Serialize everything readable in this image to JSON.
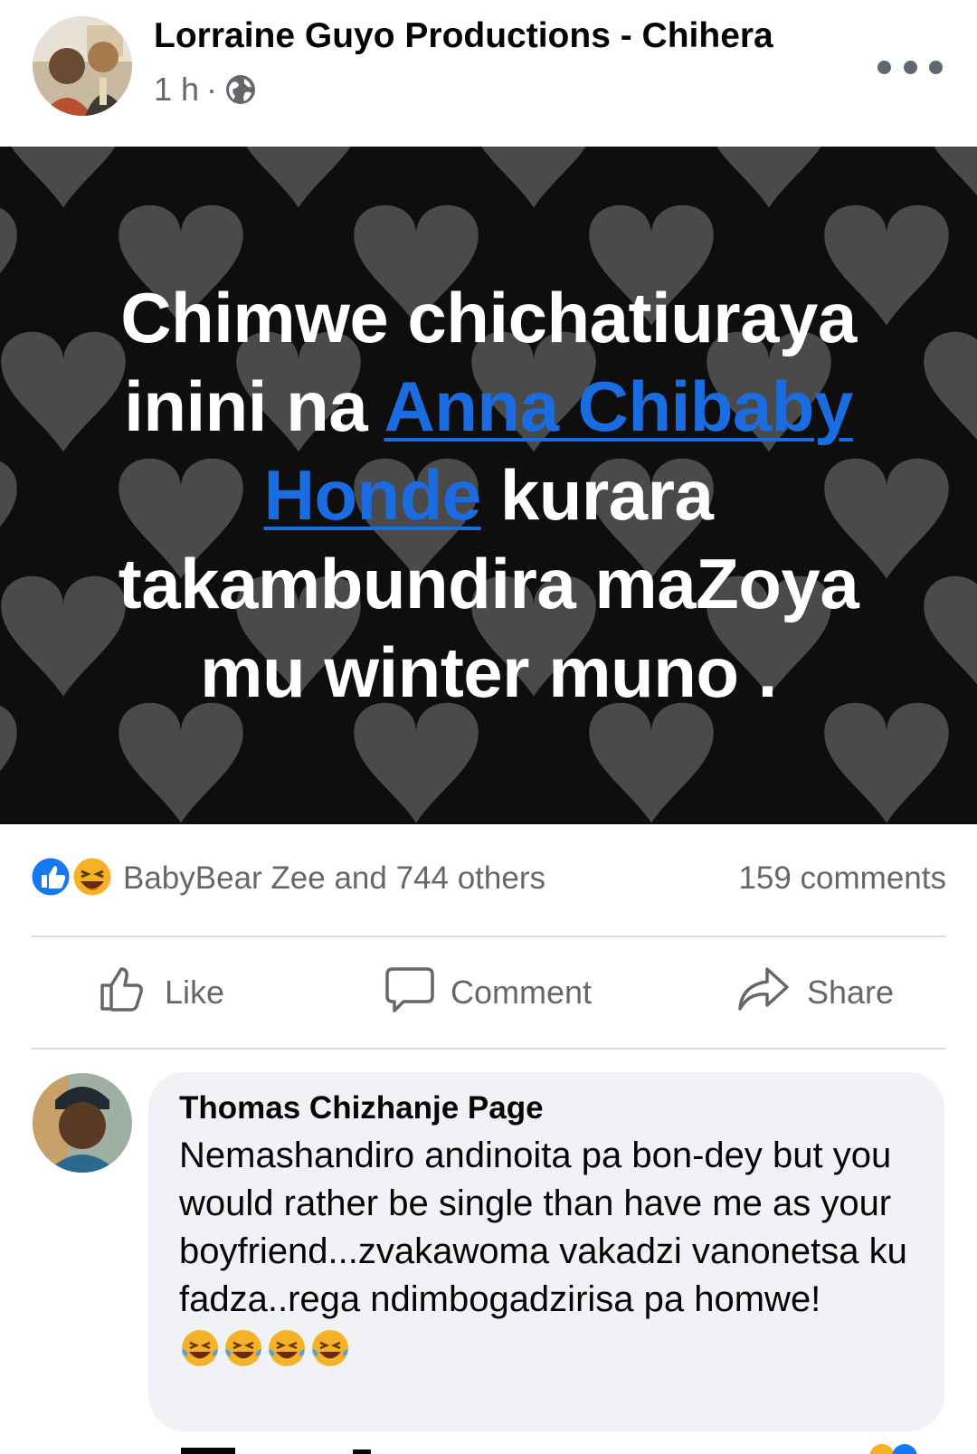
{
  "post": {
    "page_name": "Lorraine Guyo Productions - Chihera",
    "time": "1 h",
    "separator": "·",
    "privacy_icon": "globe-icon",
    "more_icon": "more-dots-icon",
    "text": {
      "line1": "Chimwe chichatiuraya",
      "line2_before": "inini na ",
      "mention": "Anna Chibaby Honde",
      "line3_after": " kurara takambundira maZoya mu winter muno ."
    },
    "background": "black-with-grey-hearts"
  },
  "reactions": {
    "icons": [
      "like-reaction-icon",
      "haha-reaction-icon"
    ],
    "names": "BabyBear Zee and 744 others",
    "comments": "159 comments"
  },
  "actions": {
    "like": "Like",
    "comment": "Comment",
    "share": "Share"
  },
  "comment": {
    "author": "Thomas Chizhanje Page",
    "text": "Nemashandiro andinoita pa bon-dey but you would rather be single than have me as your boyfriend...zvakawoma vakadzi vanonetsa ku fadza..rega ndimbogadzirisa pa homwe!",
    "emojis": [
      "laughing-crying-emoji",
      "laughing-crying-emoji",
      "laughing-crying-emoji",
      "laughing-crying-emoji"
    ]
  },
  "colors": {
    "accent": "#1b6ce0",
    "secondary_text": "#65676b",
    "bubble": "#f0f2f5"
  }
}
